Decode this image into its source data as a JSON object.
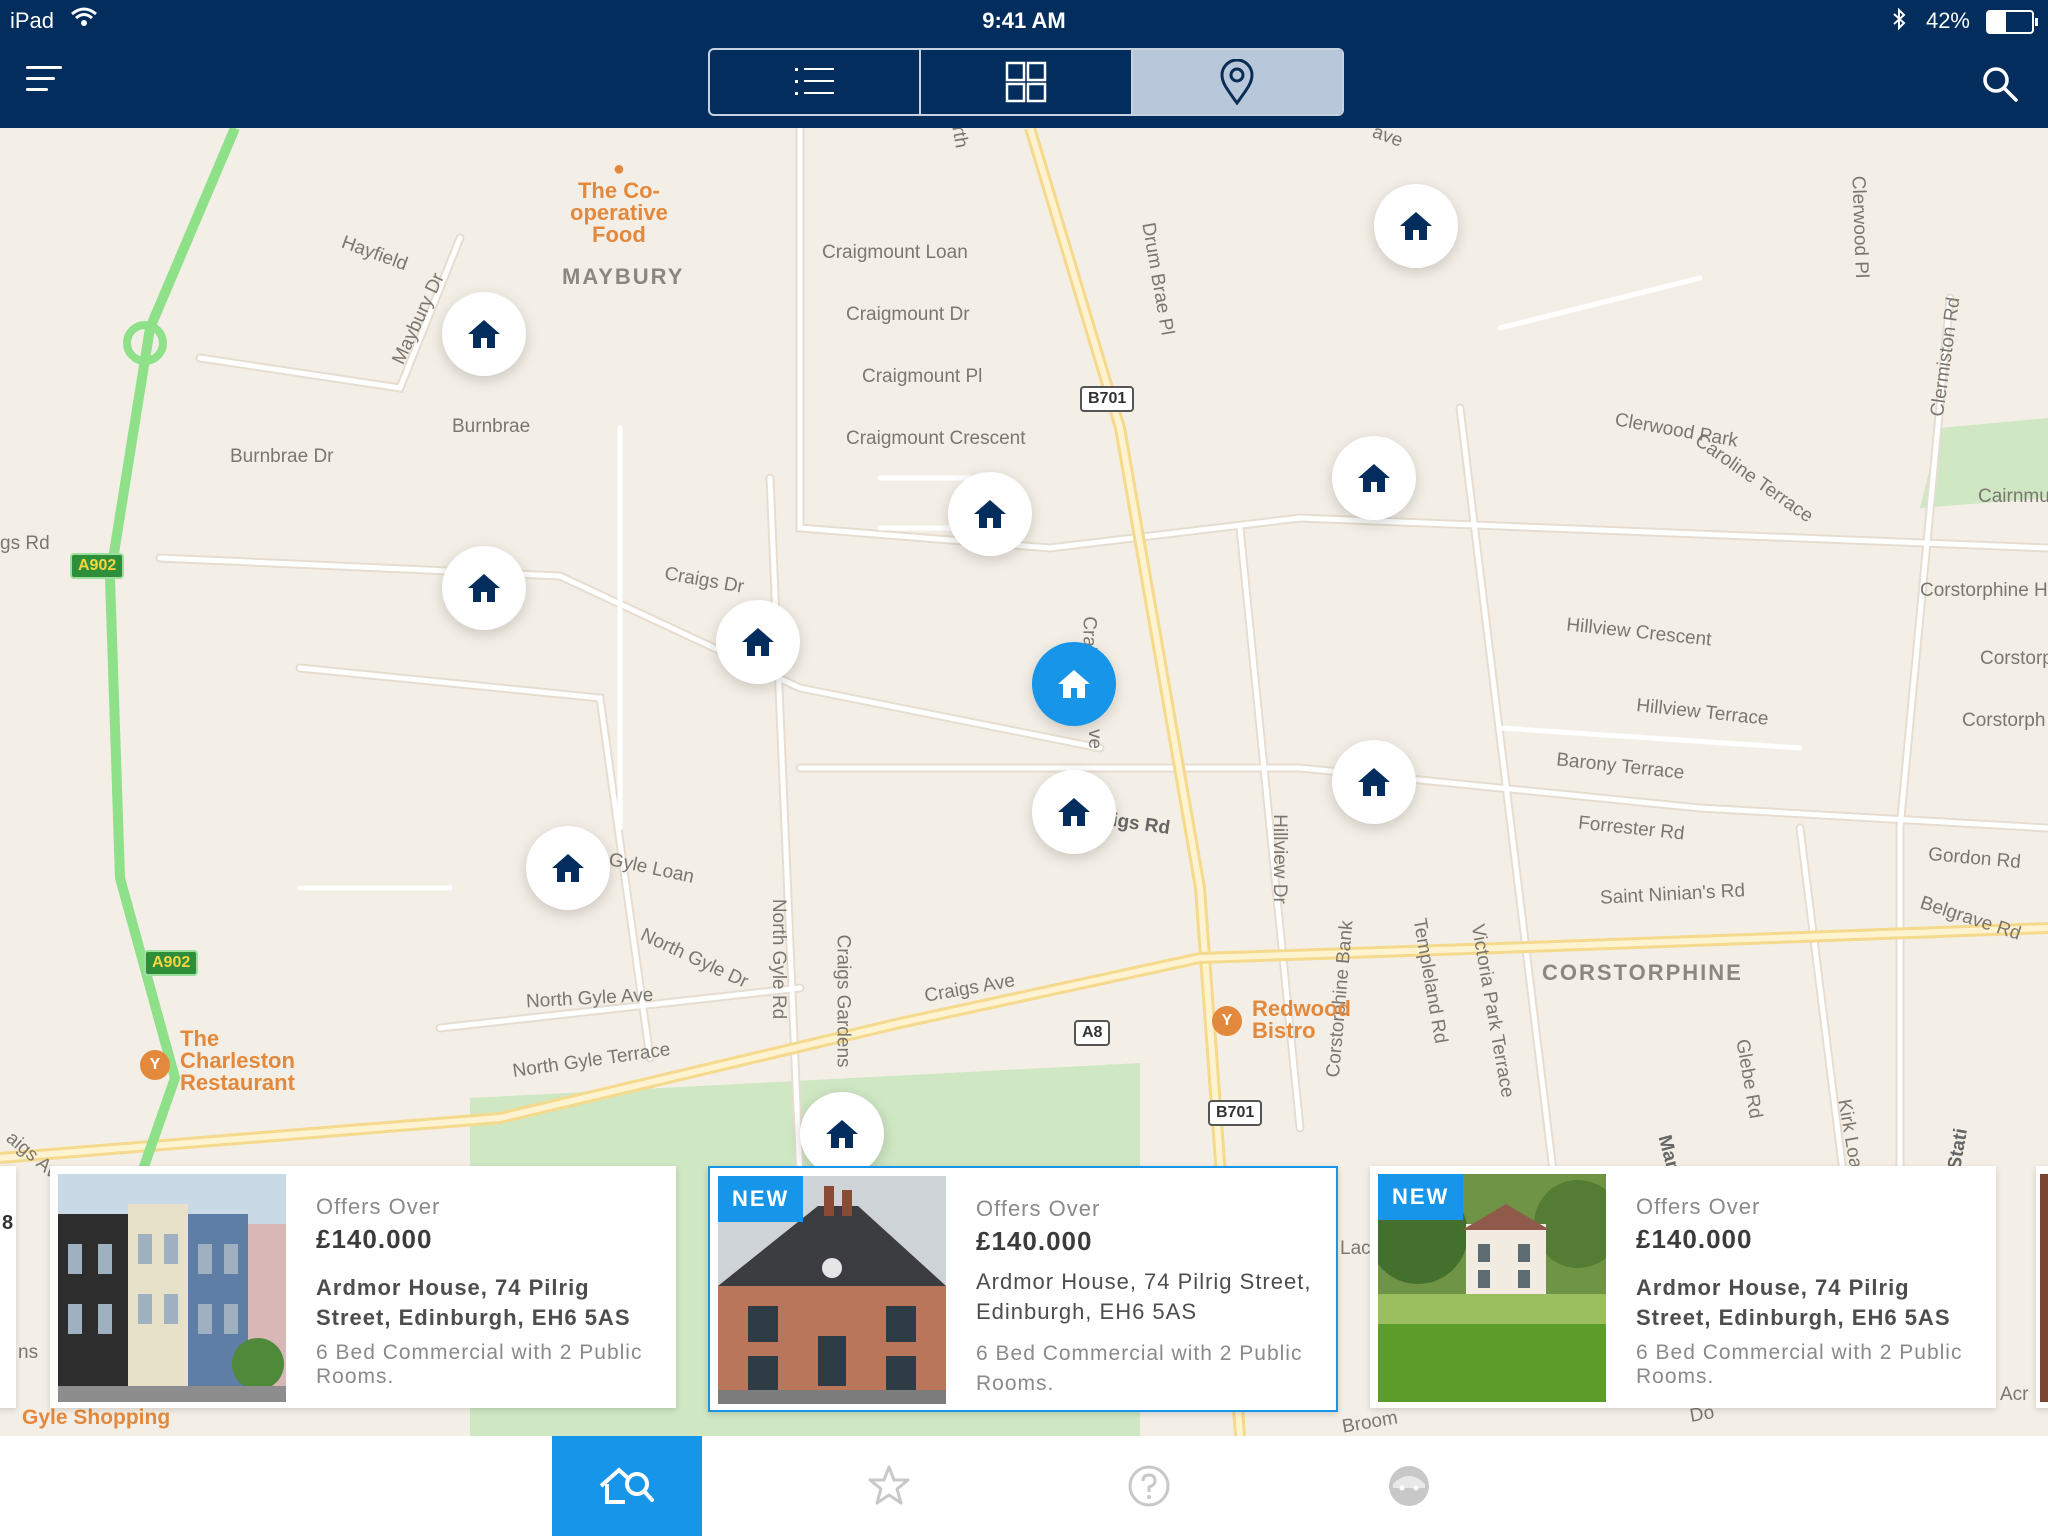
{
  "status_bar": {
    "device": "iPad",
    "time": "9:41 AM",
    "battery": "42%",
    "wifi_icon": "wifi-icon",
    "bluetooth_icon": "bluetooth-icon"
  },
  "nav": {
    "menu_icon": "menu-icon",
    "search_icon": "search-icon",
    "view_modes": [
      {
        "name": "list-view",
        "icon": "list-icon",
        "active": false
      },
      {
        "name": "grid-view",
        "icon": "grid-icon",
        "active": false
      },
      {
        "name": "map-view",
        "icon": "map-pin-icon",
        "active": true
      }
    ]
  },
  "map": {
    "areas": [
      "MAYBURY",
      "CORSTORPHINE"
    ],
    "streets": [
      "Hayfield",
      "Maybury Dr",
      "Burnbrae",
      "Burnbrae Dr",
      "Craigmount Loan",
      "Craigmount Dr",
      "Craigmount Pl",
      "Craigmount Crescent",
      "Craigs Dr",
      "gs Rd",
      "Drum Brae Pl",
      "Clerwood Park",
      "Caroline Terrace",
      "Hillview Crescent",
      "Hillview Terrace",
      "Barony Terrace",
      "Forrester Rd",
      "Saint Ninian's Rd",
      "Gyle Loan",
      "North Gyle Dr",
      "North Gyle Ave",
      "North Gyle Terrace",
      "Craigs Ave",
      "igs Rd",
      "Corstorphine Hill",
      "Gordon Rd",
      "Belgrave Rd",
      "Clermiston Rd",
      "Clerwood Pl",
      "Cairnmu",
      "Corstorp",
      "Corstorph",
      "North Gyle Rd",
      "Craigs Gardens",
      "Hillview Dr",
      "Templeland Rd",
      "Victoria Park Terrace",
      "Corstorphine Bank",
      "Glebe Rd",
      "Manse Rd",
      "Kirk Loan",
      "aigs Ave",
      "Gyle Shopping",
      "rth",
      "ave",
      "Craig",
      "ve",
      "Stati",
      "Lac",
      "Broom",
      "Do",
      "Acr",
      "ns"
    ],
    "pois": [
      {
        "name": "The Co-operative Food",
        "lines": [
          "The Co-",
          "operative",
          "Food"
        ]
      },
      {
        "name": "The Charleston Restaurant",
        "lines": [
          "The",
          "Charleston",
          "Restaurant"
        ]
      },
      {
        "name": "Redwood Bistro",
        "lines": [
          "Redwood",
          "Bistro"
        ]
      }
    ],
    "road_shields": [
      "A902",
      "A902",
      "B701",
      "A8",
      "B701"
    ],
    "pin_icon": "house-icon",
    "pin_count": 11,
    "active_pin_index": 7
  },
  "listings": [
    {
      "partial": true,
      "label": "8"
    },
    {
      "new": false,
      "offer_label": "Offers Over",
      "price": "£140.000",
      "address": "Ardmor House, 74 Pilrig Street, Edinburgh, EH6 5AS",
      "description": "6 Bed Commercial with 2 Public Rooms.",
      "selected": false
    },
    {
      "new": true,
      "new_label": "NEW",
      "offer_label": "Offers Over",
      "price": "£140.000",
      "address": "Ardmor House, 74 Pilrig Street, Edinburgh, EH6 5AS",
      "description": "6 Bed Commercial with 2 Public Rooms.",
      "selected": true
    },
    {
      "new": true,
      "new_label": "NEW",
      "offer_label": "Offers Over",
      "price": "£140.000",
      "address": "Ardmor House, 74 Pilrig Street, Edinburgh, EH6 5AS",
      "description": "6 Bed Commercial with 2 Public Rooms.",
      "selected": false
    }
  ],
  "tabbar": [
    {
      "icon": "home-search-icon",
      "active": true
    },
    {
      "icon": "star-icon",
      "active": false
    },
    {
      "icon": "help-icon",
      "active": false
    },
    {
      "icon": "profile-icon",
      "active": false
    }
  ],
  "colors": {
    "nav": "#032d5c",
    "accent": "#1795e8",
    "map_bg": "#f4efe6",
    "pin_icon": "#032d5c"
  }
}
